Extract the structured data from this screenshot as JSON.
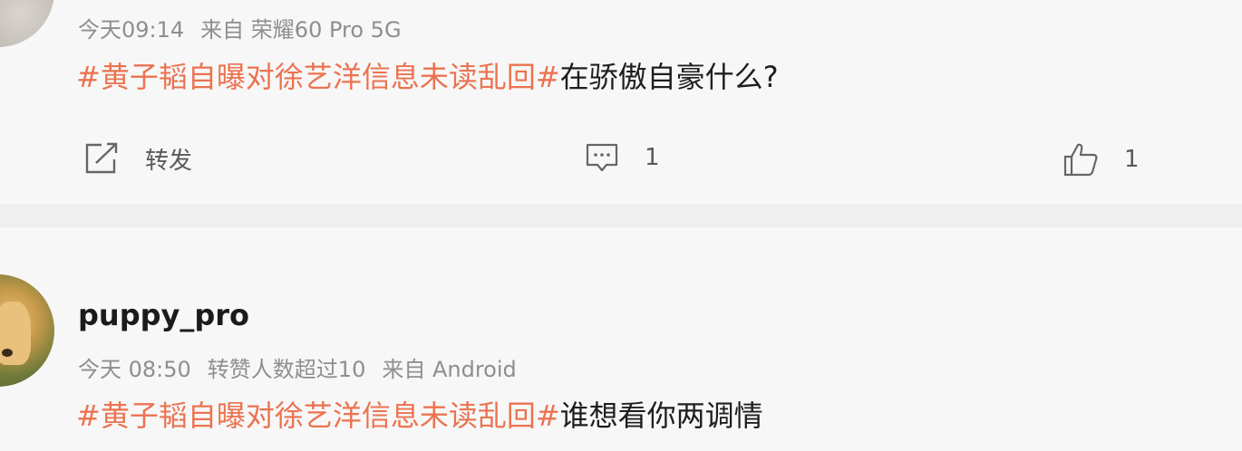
{
  "comment1": {
    "meta": {
      "time": "今天09:14",
      "source": "来自 荣耀60 Pro 5G"
    },
    "hashtag": "#黄子韬自曝对徐艺洋信息未读乱回#",
    "text": "在骄傲自豪什么?",
    "actions": {
      "repost_label": "转发",
      "comment_count": "1",
      "like_count": "1"
    }
  },
  "comment2": {
    "username": "puppy_pro",
    "meta": {
      "time": "今天 08:50",
      "reposts_likes": "转赞人数超过10",
      "source": "来自 Android"
    },
    "hashtag": "#黄子韬自曝对徐艺洋信息未读乱回#",
    "text": "谁想看你两调情"
  },
  "icons": {
    "repost": "repost-icon",
    "comment": "comment-icon",
    "like": "thumbs-up-icon"
  },
  "colors": {
    "hashtag": "#eb7350",
    "meta": "#8e8e8e"
  }
}
